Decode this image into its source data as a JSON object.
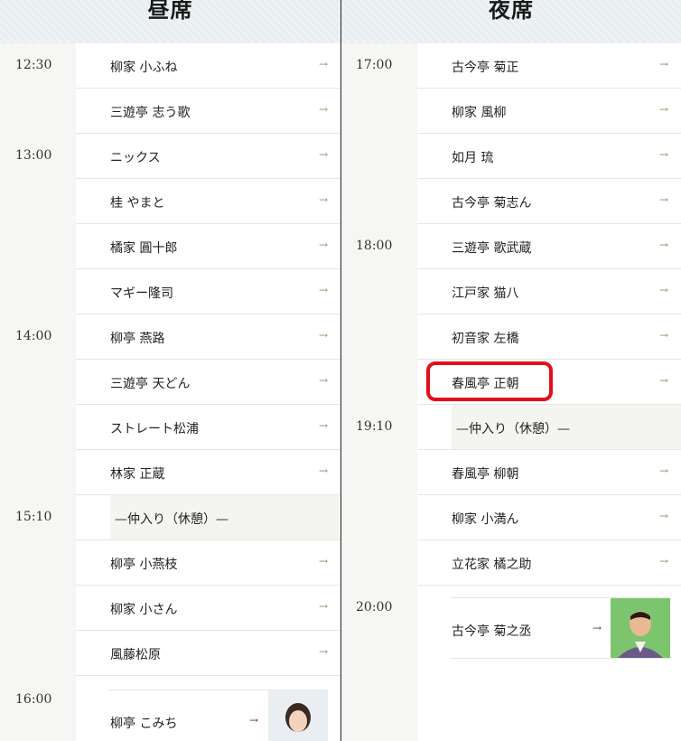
{
  "day": {
    "title": "昼席",
    "rows": [
      {
        "time": "12:30",
        "name": "柳家 小ふね"
      },
      {
        "time": "",
        "name": "三遊亭 志う歌"
      },
      {
        "time": "13:00",
        "name": "ニックス"
      },
      {
        "time": "",
        "name": "桂 やまと"
      },
      {
        "time": "",
        "name": "橘家 圓十郎"
      },
      {
        "time": "",
        "name": "マギー隆司"
      },
      {
        "time": "14:00",
        "name": "柳亭 燕路"
      },
      {
        "time": "",
        "name": "三遊亭 天どん"
      },
      {
        "time": "",
        "name": "ストレート松浦"
      },
      {
        "time": "",
        "name": "林家 正蔵"
      },
      {
        "time": "15:10",
        "name": "—仲入り（休憩）—",
        "break": true
      },
      {
        "time": "",
        "name": "柳亭 小燕枝"
      },
      {
        "time": "",
        "name": "柳家 小さん"
      },
      {
        "time": "",
        "name": "風藤松原"
      }
    ],
    "headliner": {
      "time": "16:00",
      "name": "柳亭 こみち"
    }
  },
  "night": {
    "title": "夜席",
    "rows": [
      {
        "time": "17:00",
        "name": "古今亭 菊正"
      },
      {
        "time": "",
        "name": "柳家 風柳"
      },
      {
        "time": "",
        "name": "如月 琉"
      },
      {
        "time": "",
        "name": "古今亭 菊志ん"
      },
      {
        "time": "18:00",
        "name": "三遊亭 歌武蔵"
      },
      {
        "time": "",
        "name": "江戸家 猫八"
      },
      {
        "time": "",
        "name": "初音家 左橋"
      },
      {
        "time": "",
        "name": "春風亭 正朝",
        "highlighted": true
      },
      {
        "time": "19:10",
        "name": "—仲入り（休憩）—",
        "break": true
      },
      {
        "time": "",
        "name": "春風亭 柳朝"
      },
      {
        "time": "",
        "name": "柳家 小満ん"
      },
      {
        "time": "",
        "name": "立花家 橘之助"
      }
    ],
    "headliner": {
      "time": "20:00",
      "name": "古今亭 菊之丞"
    }
  },
  "icons": {
    "arrow": "→",
    "arrow_icon": "arrow-right-icon"
  },
  "colors": {
    "header_bg": "#e8eef1",
    "accent_arrow": "#9a8a5a",
    "highlight": "#e0101a",
    "break_bg": "#f4f4f1",
    "photo_bg_day": "#dce6ee",
    "photo_bg_night": "#7cc46e"
  }
}
